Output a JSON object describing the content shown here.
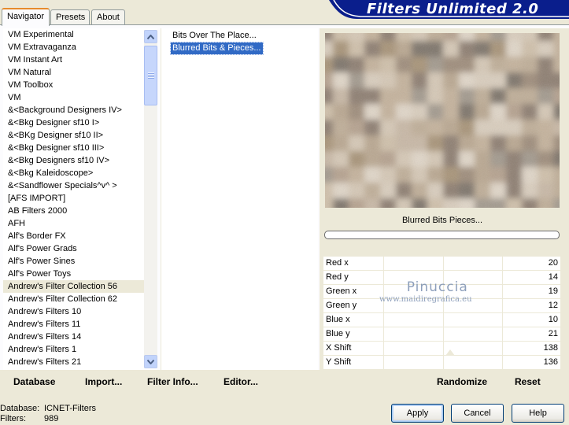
{
  "tabs": [
    "Navigator",
    "Presets",
    "About"
  ],
  "app_title": "Filters Unlimited 2.0",
  "categories": [
    "VM Experimental",
    "VM Extravaganza",
    "VM Instant Art",
    "VM Natural",
    "VM Toolbox",
    "VM",
    "&<Background Designers IV>",
    "&<Bkg Designer sf10 I>",
    "&<BKg Designer sf10 II>",
    "&<Bkg Designer sf10 III>",
    "&<Bkg Designers sf10 IV>",
    "&<Bkg Kaleidoscope>",
    "&<Sandflower Specials^v^ >",
    "[AFS IMPORT]",
    "AB Filters 2000",
    "AFH",
    "Alf's Border FX",
    "Alf's Power Grads",
    "Alf's Power Sines",
    "Alf's Power Toys",
    "Andrew's Filter Collection 56",
    "Andrew's Filter Collection 62",
    "Andrew's Filters 10",
    "Andrew's Filters 11",
    "Andrew's Filters 14",
    "Andrew's Filters 1",
    "Andrew's Filters 21"
  ],
  "selected_category": "Andrew's Filter Collection 56",
  "filters": [
    "Bits Over The Place...",
    "Blurred Bits & Pieces..."
  ],
  "selected_filter": "Blurred Bits & Pieces...",
  "filter_display_name": "Blurred Bits  Pieces...",
  "params": [
    {
      "label": "Red x",
      "value": "20"
    },
    {
      "label": "Red y",
      "value": "14"
    },
    {
      "label": "Green x",
      "value": "19"
    },
    {
      "label": "Green y",
      "value": "12"
    },
    {
      "label": "Blue x",
      "value": "10"
    },
    {
      "label": "Blue y",
      "value": "21"
    },
    {
      "label": "X Shift",
      "value": "138"
    },
    {
      "label": "Y Shift",
      "value": "136"
    }
  ],
  "watermark": {
    "line1": "Pinuccia",
    "line2": "www.maidiregrafica.eu"
  },
  "function_buttons": {
    "database": "Database",
    "import": "Import...",
    "filter_info": "Filter Info...",
    "editor": "Editor...",
    "randomize": "Randomize",
    "reset": "Reset"
  },
  "status": {
    "database_label": "Database:",
    "database_value": "ICNET-Filters",
    "filters_label": "Filters:",
    "filters_value": "989"
  },
  "dialog_buttons": {
    "apply": "Apply",
    "cancel": "Cancel",
    "help": "Help"
  },
  "colors": {
    "selection": "#316ac5",
    "banner": "#0a1e8c",
    "accent_tab": "#e68b2c"
  }
}
